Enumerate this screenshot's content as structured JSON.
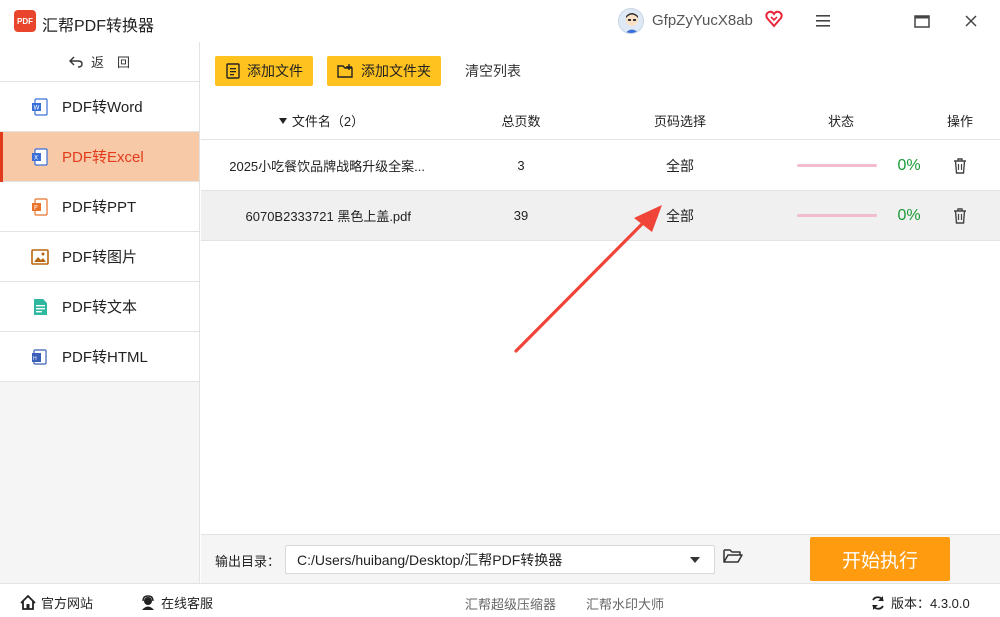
{
  "app": {
    "title": "汇帮PDF转换器",
    "logo_text": "PDF",
    "user_name": "GfpZyYucX8ab"
  },
  "sidebar": {
    "back_label": "返　回",
    "items": [
      {
        "label": "PDF转Word",
        "icon": "word-icon",
        "color": "#3a6fd8"
      },
      {
        "label": "PDF转Excel",
        "icon": "excel-icon",
        "color": "#3a6fd8"
      },
      {
        "label": "PDF转PPT",
        "icon": "ppt-icon",
        "color": "#e8742c"
      },
      {
        "label": "PDF转图片",
        "icon": "image-icon",
        "color": "#b8660f"
      },
      {
        "label": "PDF转文本",
        "icon": "text-icon",
        "color": "#2fb8a0"
      },
      {
        "label": "PDF转HTML",
        "icon": "html-icon",
        "color": "#3a5fb8"
      }
    ],
    "active_index": 1
  },
  "toolbar": {
    "add_file": "添加文件",
    "add_folder": "添加文件夹",
    "clear_list": "清空列表"
  },
  "table": {
    "headers": {
      "filename": "文件名（2）",
      "pages": "总页数",
      "page_select": "页码选择",
      "status": "状态",
      "action": "操作"
    },
    "rows": [
      {
        "filename": "2025小吃餐饮品牌战略升级全案...",
        "pages": "3",
        "page_select": "全部",
        "progress": "0%"
      },
      {
        "filename": "6070B2333721 黑色上盖.pdf",
        "pages": "39",
        "page_select": "全部",
        "progress": "0%"
      }
    ]
  },
  "output": {
    "label": "输出目录：",
    "path": "C:/Users/huibang/Desktop/汇帮PDF转换器",
    "start_label": "开始执行"
  },
  "footer": {
    "official_site": "官方网站",
    "online_service": "在线客服",
    "link1": "汇帮超级压缩器",
    "link2": "汇帮水印大师",
    "version": "版本：4.3.0.0"
  },
  "colors": {
    "accent": "#ffc21f",
    "start": "#ff9b0f",
    "active_bg": "#f7c9a6",
    "active_text": "#e23b1c",
    "progress_ok": "#1a9a35",
    "arrow": "#f04438"
  }
}
